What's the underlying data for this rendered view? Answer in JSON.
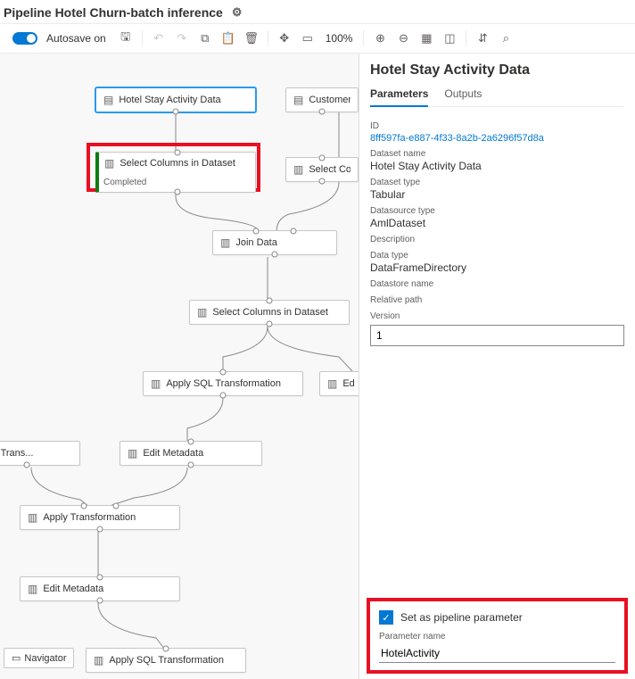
{
  "title": "Pipeline Hotel Churn-batch inference",
  "toolbar": {
    "autosave_label": "Autosave on",
    "zoom": "100%"
  },
  "nodes": {
    "hotel_stay": "Hotel Stay Activity Data",
    "customer_data": "Customer Dat",
    "select_cols1": "Select Columns in Dataset",
    "select_cols1_status": "Completed",
    "select_cols2": "Select Colum",
    "join_data": "Join Data",
    "select_cols3": "Select Columns in Dataset",
    "apply_sql1": "Apply SQL Transformation",
    "edit_m_cut": "Edit M",
    "vals_trans": "tor Values Trans...",
    "edit_meta1": "Edit Metadata",
    "apply_trans": "Apply Transformation",
    "edit_meta2": "Edit Metadata",
    "apply_sql2": "Apply SQL Transformation"
  },
  "panel": {
    "title": "Hotel Stay Activity Data",
    "tab_parameters": "Parameters",
    "tab_outputs": "Outputs",
    "labels": {
      "id": "ID",
      "dataset_name": "Dataset name",
      "dataset_type": "Dataset type",
      "datasource_type": "Datasource type",
      "description": "Description",
      "data_type": "Data type",
      "datastore_name": "Datastore name",
      "relative_path": "Relative path",
      "version": "Version",
      "set_pipe_param": "Set as pipeline parameter",
      "param_name": "Parameter name"
    },
    "values": {
      "id": "8ff597fa-e887-4f33-8a2b-2a6296f57d8a",
      "dataset_name": "Hotel Stay Activity Data",
      "dataset_type": "Tabular",
      "datasource_type": "AmlDataset",
      "description": "",
      "data_type": "DataFrameDirectory",
      "datastore_name": "",
      "relative_path": "",
      "version": "1",
      "param_name": "HotelActivity"
    }
  },
  "navigator": "Navigator"
}
